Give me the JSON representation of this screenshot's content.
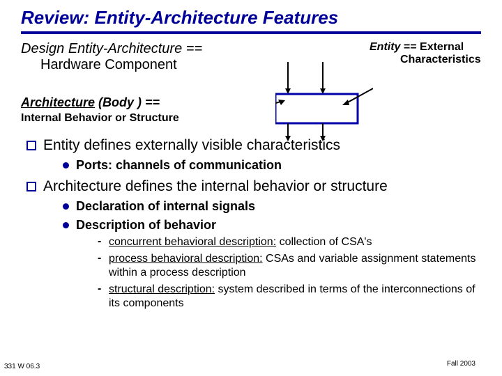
{
  "title": "Review:  Entity-Architecture Features",
  "design_entity": {
    "line1_italic": "Design Entity-Architecture  ==",
    "line2": "Hardware Component"
  },
  "entity_external": {
    "part1": "Entity",
    "part2": " == External",
    "part3": "Characteristics"
  },
  "arch_body": {
    "underlined": "Architecture",
    "rest": " (Body )  ==",
    "sub": "Internal Behavior or Structure"
  },
  "bullets": {
    "b1": "Entity defines externally visible characteristics",
    "b1_sub1": "Ports: channels of communication",
    "b2": "Architecture defines the internal behavior or structure",
    "b2_sub1": "Declaration of internal signals",
    "b2_sub2": "Description of behavior",
    "b2_d1_label": "concurrent behavioral description:",
    "b2_d1_rest": "  collection of CSA's",
    "b2_d2_label": "process behavioral description:",
    "b2_d2_rest": "  CSAs and variable assignment statements within a process description",
    "b2_d3_label": "structural description:",
    "b2_d3_rest": "  system described in terms of the interconnections of its components"
  },
  "footer": {
    "slide_num": "331  W 06.3",
    "term": "Fall 2003"
  }
}
